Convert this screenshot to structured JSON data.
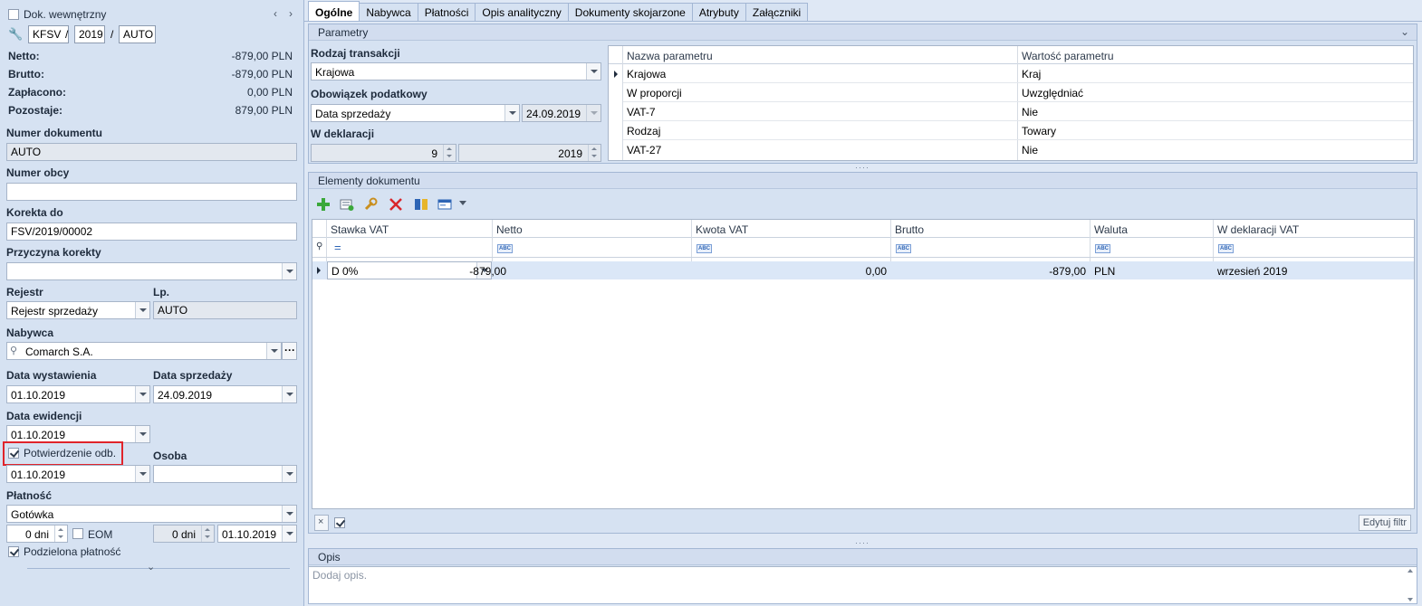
{
  "left": {
    "doc_type_label": "Dok. wewnętrzny",
    "number_parts": [
      "KFSV",
      "2019",
      "AUTO"
    ],
    "separator": "/",
    "summary": [
      {
        "label": "Netto:",
        "value": "-879,00 PLN"
      },
      {
        "label": "Brutto:",
        "value": "-879,00 PLN"
      },
      {
        "label": "Zapłacono:",
        "value": "0,00 PLN"
      },
      {
        "label": "Pozostaje:",
        "value": "879,00 PLN"
      }
    ],
    "numer_dokumentu_label": "Numer dokumentu",
    "numer_dokumentu_value": "AUTO",
    "numer_obcy_label": "Numer obcy",
    "numer_obcy_value": "",
    "korekta_do_label": "Korekta do",
    "korekta_do_value": "FSV/2019/00002",
    "przyczyna_label": "Przyczyna korekty",
    "przyczyna_value": "",
    "rejestr_label": "Rejestr",
    "rejestr_value": "Rejestr sprzedaży",
    "lp_label": "Lp.",
    "lp_value": "AUTO",
    "nabywca_label": "Nabywca",
    "nabywca_value": "Comarch S.A.",
    "ellipsis": "···",
    "data_wystawienia_label": "Data wystawienia",
    "data_wystawienia_value": "01.10.2019",
    "data_sprzedazy_label": "Data sprzedaży",
    "data_sprzedazy_value": "24.09.2019",
    "data_ewidencji_label": "Data ewidencji",
    "data_ewidencji_value": "01.10.2019",
    "potwierdzenie_label": "Potwierdzenie odb.",
    "potwierdzenie_checked": true,
    "potwierdzenie_value": "01.10.2019",
    "osoba_label": "Osoba",
    "osoba_value": "",
    "platnosc_label": "Płatność",
    "platnosc_value": "Gotówka",
    "dni1_value": "0 dni",
    "eom_label": "EOM",
    "dni2_value": "0 dni",
    "termin_value": "01.10.2019",
    "podzielona_label": "Podzielona płatność",
    "highlight_color": "#e0242b"
  },
  "tabs": [
    "Ogólne",
    "Nabywca",
    "Płatności",
    "Opis analityczny",
    "Dokumenty skojarzone",
    "Atrybuty",
    "Załączniki"
  ],
  "parametry": {
    "title": "Parametry",
    "rodzaj_label": "Rodzaj transakcji",
    "rodzaj_value": "Krajowa",
    "obowiazek_label": "Obowiązek podatkowy",
    "obowiazek_value": "Data sprzedaży",
    "obowiazek_date": "24.09.2019",
    "deklaracja_label": "W deklaracji",
    "deklaracja_month": "9",
    "deklaracja_year": "2019",
    "grid_headers": [
      "Nazwa parametru",
      "Wartość parametru"
    ],
    "grid_rows": [
      {
        "name": "Krajowa",
        "value": "Kraj"
      },
      {
        "name": "W proporcji",
        "value": "Uwzględniać"
      },
      {
        "name": "VAT-7",
        "value": "Nie"
      },
      {
        "name": "Rodzaj",
        "value": "Towary"
      },
      {
        "name": "VAT-27",
        "value": "Nie"
      }
    ]
  },
  "elementy": {
    "title": "Elementy dokumentu",
    "headers": [
      "Stawka VAT",
      "Netto",
      "Kwota VAT",
      "Brutto",
      "Waluta",
      "W deklaracji VAT"
    ],
    "filter_equals": "=",
    "filter_abc": "ABC",
    "row": {
      "stawka": "D 0%",
      "netto": "-879,00",
      "kwota": "0,00",
      "brutto": "-879,00",
      "waluta": "PLN",
      "deklaracja": "wrzesień 2019"
    },
    "edit_filter_label": "Edytuj filtr"
  },
  "opis": {
    "title": "Opis",
    "placeholder": "Dodaj opis."
  }
}
